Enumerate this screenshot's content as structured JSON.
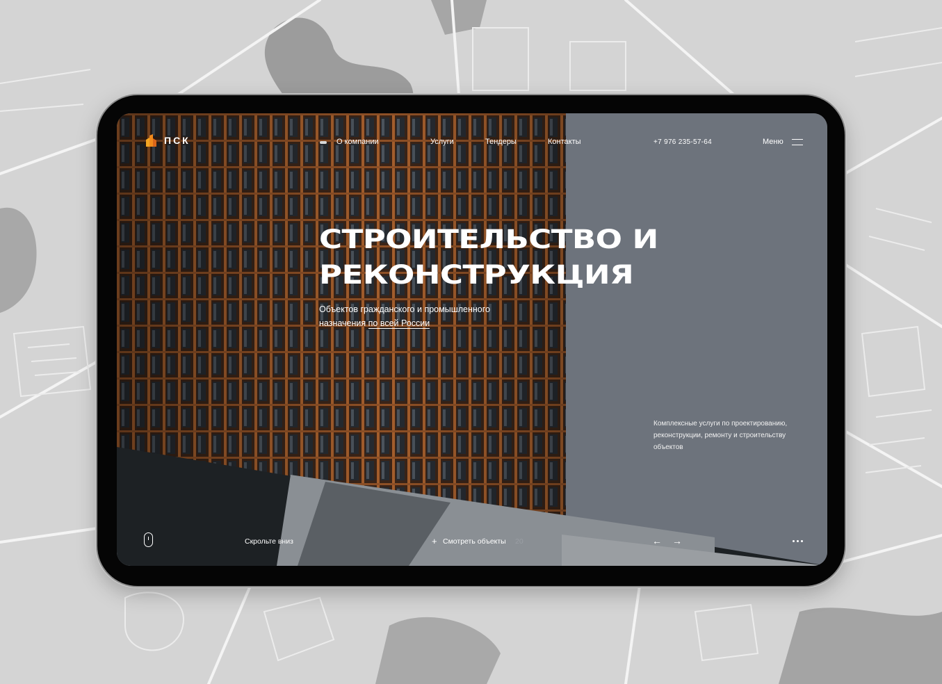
{
  "brand": {
    "name": "ПСК"
  },
  "nav": {
    "items": [
      "О компании",
      "Услуги",
      "Тендеры",
      "Контакты"
    ]
  },
  "header": {
    "phone": "+7  976  235-57-64",
    "menu_label": "Меню"
  },
  "hero": {
    "title_line1": "Строительство и",
    "title_line2": "реконструкция",
    "subtitle_line1": "Объектов гражданского и промышленного",
    "subtitle_prefix": "назначения ",
    "subtitle_link": "по всей России",
    "description": "Комплексные услуги по проектированию, реконструкции, ремонту и строительству  объектов"
  },
  "footer_bar": {
    "scroll_label": "Скрольте вниз",
    "view_plus": "+",
    "view_label": "Смотреть объекты",
    "view_count": "20",
    "prev_arrow": "←",
    "next_arrow": "→"
  },
  "colors": {
    "accent": "#f08a1c",
    "sky": "#6d737c",
    "frame": "#050505",
    "map_bg": "#d4d4d4"
  },
  "icons": [
    "logo-icon",
    "mouse-icon",
    "burger-menu-icon",
    "arrow-left-icon",
    "arrow-right-icon",
    "more-dots-icon"
  ]
}
